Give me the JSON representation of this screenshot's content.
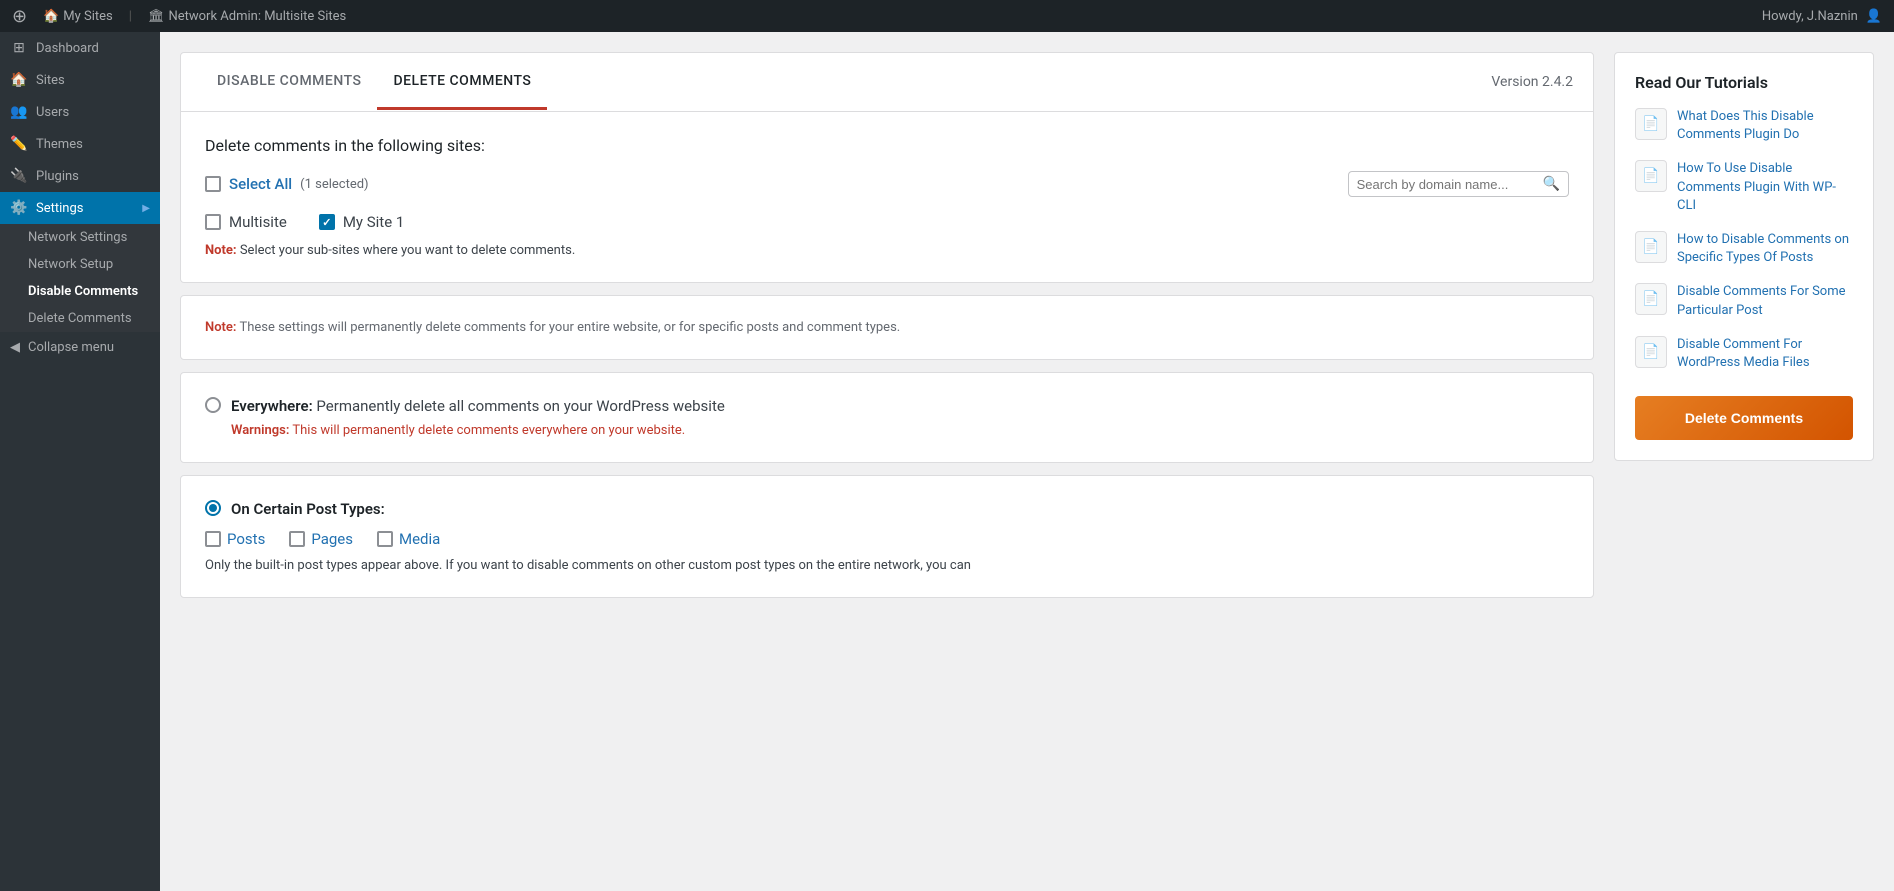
{
  "topbar": {
    "wp_logo": "⊕",
    "my_sites_label": "My Sites",
    "network_admin_label": "Network Admin: Multisite Sites",
    "howdy_label": "Howdy, J.Naznin",
    "avatar_symbol": "👤"
  },
  "sidebar": {
    "items": [
      {
        "id": "dashboard",
        "label": "Dashboard",
        "icon": "⊞"
      },
      {
        "id": "sites",
        "label": "Sites",
        "icon": "🏠"
      },
      {
        "id": "users",
        "label": "Users",
        "icon": "👥"
      },
      {
        "id": "themes",
        "label": "Themes",
        "icon": "✏️"
      },
      {
        "id": "plugins",
        "label": "Plugins",
        "icon": "🔌"
      },
      {
        "id": "settings",
        "label": "Settings",
        "icon": "⚙️",
        "active": true,
        "has_arrow": true
      }
    ],
    "submenu": [
      {
        "id": "network-settings",
        "label": "Network Settings"
      },
      {
        "id": "network-setup",
        "label": "Network Setup"
      },
      {
        "id": "disable-comments",
        "label": "Disable Comments",
        "active": true
      },
      {
        "id": "delete-comments",
        "label": "Delete Comments"
      }
    ],
    "collapse_label": "Collapse menu"
  },
  "tabs": [
    {
      "id": "disable-comments",
      "label": "DISABLE COMMENTS",
      "active": false
    },
    {
      "id": "delete-comments",
      "label": "DELETE COMMENTS",
      "active": true
    }
  ],
  "version": "Version 2.4.2",
  "sites_section": {
    "title": "Delete comments in the following sites:",
    "select_all_label": "Select All",
    "select_all_count": "(1 selected)",
    "search_placeholder": "Search by domain name...",
    "sites": [
      {
        "id": "multisite",
        "label": "Multisite",
        "checked": false
      },
      {
        "id": "my-site-1",
        "label": "My Site 1",
        "checked": true
      }
    ],
    "note_label": "Note:",
    "note_text": "Select your sub-sites where you want to delete comments."
  },
  "warning_section": {
    "note_label": "Note:",
    "note_text": "These settings will permanently delete comments for your entire website, or for specific posts and comment types."
  },
  "everywhere_section": {
    "label": "Everywhere:",
    "description": "Permanently delete all comments on your WordPress website",
    "warning_label": "Warnings:",
    "warning_text": "This will permanently delete comments everywhere on your website.",
    "checked": false
  },
  "post_types_section": {
    "label": "On Certain Post Types:",
    "checked": true,
    "types": [
      {
        "id": "posts",
        "label": "Posts",
        "checked": false
      },
      {
        "id": "pages",
        "label": "Pages",
        "checked": false
      },
      {
        "id": "media",
        "label": "Media",
        "checked": false
      }
    ],
    "note": "Only the built-in post types appear above. If you want to disable comments on other custom post types on the entire network, you can"
  },
  "tutorials": {
    "title": "Read Our Tutorials",
    "items": [
      {
        "id": "what-does",
        "text": "What Does This Disable Comments Plugin Do"
      },
      {
        "id": "how-to-use",
        "text": "How To Use Disable Comments Plugin With WP-CLI"
      },
      {
        "id": "how-to-disable-types",
        "text": "How to Disable Comments on Specific Types Of Posts"
      },
      {
        "id": "disable-particular",
        "text": "Disable Comments For Some Particular Post"
      },
      {
        "id": "disable-media",
        "text": "Disable Comment For WordPress Media Files"
      }
    ]
  }
}
